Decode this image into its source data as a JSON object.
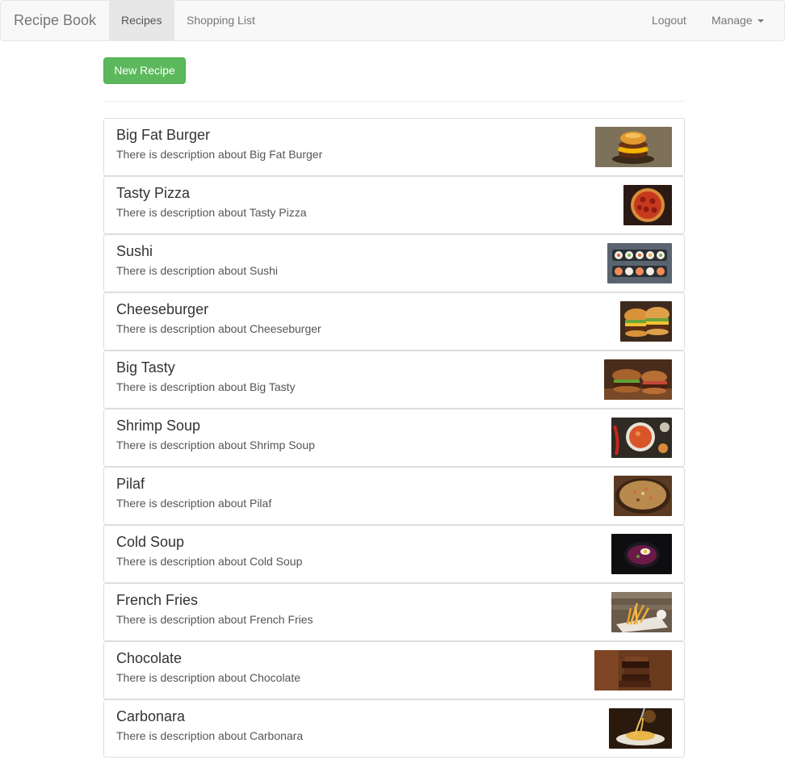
{
  "navbar": {
    "brand": "Recipe Book",
    "links": [
      {
        "label": "Recipes",
        "active": true
      },
      {
        "label": "Shopping List",
        "active": false
      }
    ],
    "logout_label": "Logout",
    "manage_label": "Manage"
  },
  "actions": {
    "new_recipe_label": "New Recipe"
  },
  "recipes": [
    {
      "name": "Big Fat Burger",
      "description": "There is description about Big Fat Burger",
      "image": "burger-photo"
    },
    {
      "name": "Tasty Pizza",
      "description": "There is description about Tasty Pizza",
      "image": "pizza-photo"
    },
    {
      "name": "Sushi",
      "description": "There is description about Sushi",
      "image": "sushi-photo"
    },
    {
      "name": "Cheeseburger",
      "description": "There is description about Cheeseburger",
      "image": "cheeseburger-photo"
    },
    {
      "name": "Big Tasty",
      "description": "There is description about Big Tasty",
      "image": "big-tasty-photo"
    },
    {
      "name": "Shrimp Soup",
      "description": "There is description about Shrimp Soup",
      "image": "shrimp-soup-photo"
    },
    {
      "name": "Pilaf",
      "description": "There is description about Pilaf",
      "image": "pilaf-photo"
    },
    {
      "name": "Cold Soup",
      "description": "There is description about Cold Soup",
      "image": "cold-soup-photo"
    },
    {
      "name": "French Fries",
      "description": "There is description about French Fries",
      "image": "french-fries-photo"
    },
    {
      "name": "Chocolate",
      "description": "There is description about Chocolate",
      "image": "chocolate-photo"
    },
    {
      "name": "Carbonara",
      "description": "There is description about Carbonara",
      "image": "carbonara-photo"
    }
  ],
  "colors": {
    "success_button": "#5cb85c",
    "navbar_bg": "#f8f8f8",
    "active_nav_bg": "#e7e7e7"
  }
}
